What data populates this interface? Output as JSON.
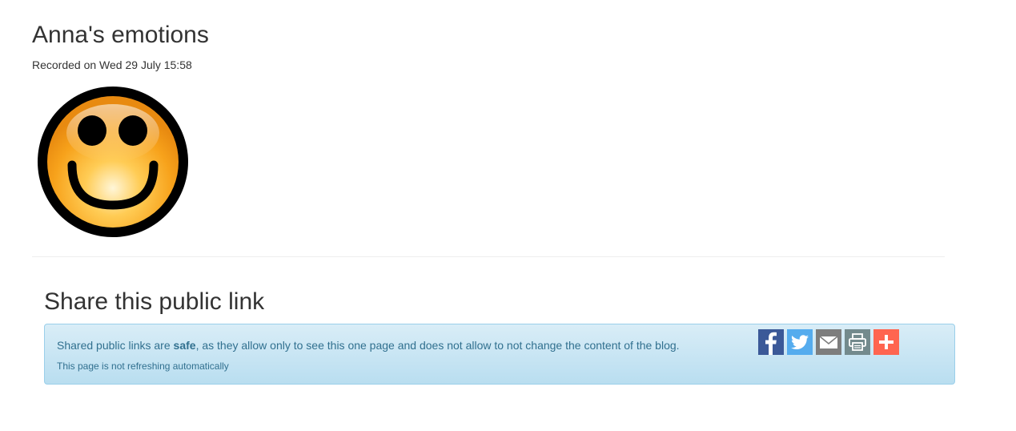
{
  "header": {
    "title": "Anna's emotions",
    "recorded": "Recorded on Wed 29 July 15:58"
  },
  "emotion": {
    "icon": "smiley-face-icon"
  },
  "share": {
    "heading": "Share this public link",
    "message_prefix": "Shared public links are ",
    "message_bold": "safe",
    "message_suffix": ", as they allow only to see this one page and does not allow to not change the content of the blog.",
    "refresh_note": "This page is not refreshing automatically",
    "buttons": [
      {
        "icon": "facebook-icon",
        "color": "#3b5998"
      },
      {
        "icon": "twitter-icon",
        "color": "#55acee"
      },
      {
        "icon": "email-icon",
        "color": "#7d7d7d"
      },
      {
        "icon": "print-icon",
        "color": "#738a8d"
      },
      {
        "icon": "plus-icon",
        "color": "#ff6550"
      }
    ]
  },
  "colors": {
    "alert_text": "#31708f",
    "alert_border": "#9acfea",
    "alert_bg_top": "#d9edf7",
    "alert_bg_bottom": "#b9def0"
  }
}
